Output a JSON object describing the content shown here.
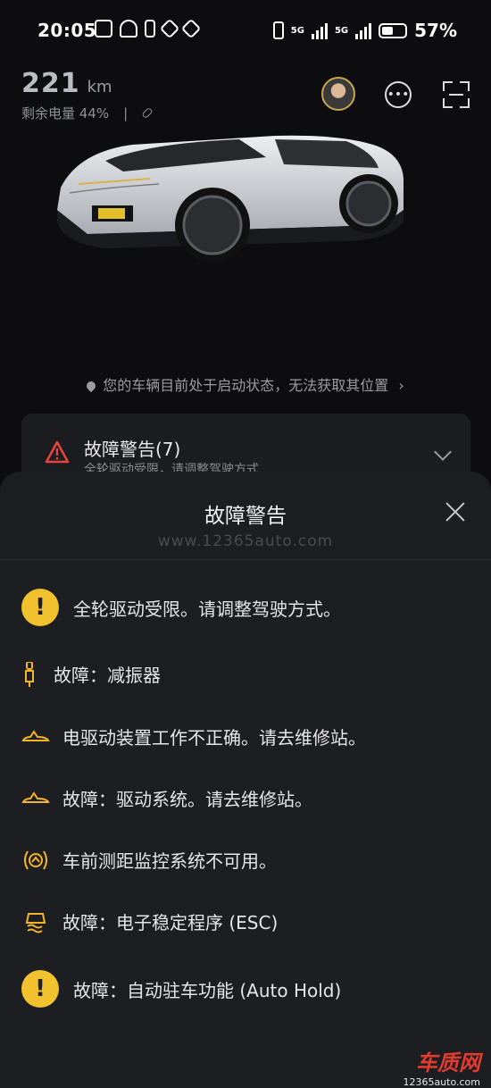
{
  "status_bar": {
    "time": "20:05",
    "battery_percent": "57%",
    "net1": "5G",
    "net2": "5G"
  },
  "vehicle": {
    "range_value": "221",
    "range_unit": "km",
    "battery_label": "剩余电量 44%",
    "separator": "|",
    "location_text": "您的车辆目前处于启动状态，无法获取其位置",
    "location_chevron": "›"
  },
  "fault_card": {
    "title": "故障警告(7)",
    "subtitle": "全轮驱动受限，请调整驾驶方式"
  },
  "sheet": {
    "title": "故障警告",
    "watermark": "www.12365auto.com",
    "items": [
      {
        "icon": "exclamation-circle-icon",
        "text": "全轮驱动受限。请调整驾驶方式。"
      },
      {
        "icon": "shock-absorber-icon",
        "text": "故障：减振器"
      },
      {
        "icon": "car-drive-icon",
        "text": "电驱动装置工作不正确。请去维修站。"
      },
      {
        "icon": "car-drive-icon",
        "text": "故障：驱动系统。请去维修站。"
      },
      {
        "icon": "distance-monitor-icon",
        "text": "车前测距监控系统不可用。"
      },
      {
        "icon": "esc-skid-icon",
        "text": "故障：电子稳定程序 (ESC)"
      },
      {
        "icon": "exclamation-circle-icon",
        "text": "故障：自动驻车功能 (Auto Hold)"
      }
    ]
  },
  "brand": {
    "logo_text": "车质网",
    "url": "12365auto.com"
  },
  "colors": {
    "background": "#0d0d0f",
    "sheet": "#1d1e22",
    "warning_yellow": "#f2c12e",
    "warning_red": "#e8453c",
    "brand_red": "#e33b2f"
  }
}
